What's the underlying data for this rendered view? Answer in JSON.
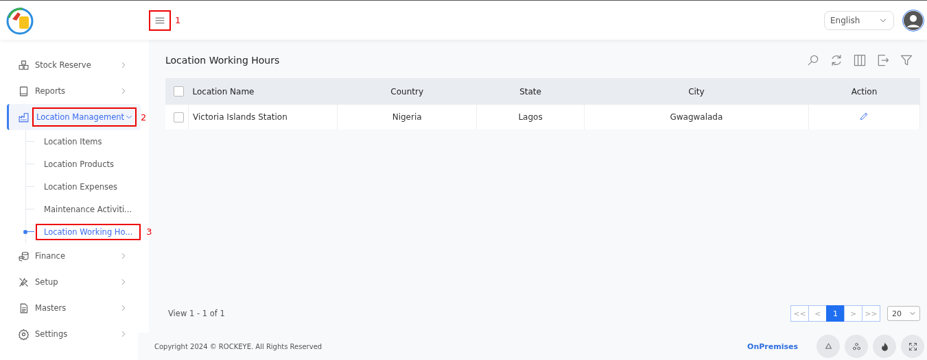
{
  "header": {
    "menu_button": {
      "annotation": "1"
    },
    "language": {
      "value": "English"
    }
  },
  "sidebar": {
    "items": [
      {
        "label": "Stock Reserve",
        "selected": false,
        "expanded": false
      },
      {
        "label": "Reports",
        "selected": false,
        "expanded": false
      },
      {
        "label": "Location Management",
        "selected": true,
        "expanded": true,
        "annotation": "2",
        "children": [
          {
            "label": "Location Items",
            "selected": false
          },
          {
            "label": "Location Products",
            "selected": false
          },
          {
            "label": "Location Expenses",
            "selected": false
          },
          {
            "label": "Maintenance Activiti...",
            "selected": false
          },
          {
            "label": "Location Working Ho...",
            "selected": true,
            "annotation": "3"
          }
        ]
      },
      {
        "label": "Finance",
        "selected": false,
        "expanded": false
      },
      {
        "label": "Setup",
        "selected": false,
        "expanded": false
      },
      {
        "label": "Masters",
        "selected": false,
        "expanded": false
      },
      {
        "label": "Settings",
        "selected": false,
        "expanded": false
      }
    ]
  },
  "page": {
    "title": "Location Working Hours"
  },
  "table": {
    "select_all": {
      "checked": false
    },
    "columns": [
      "Location Name",
      "Country",
      "State",
      "City",
      "Action"
    ],
    "rows": [
      {
        "checked": false,
        "cells": [
          "Victoria Islands Station",
          "Nigeria",
          "Lagos",
          "Gwagwalada"
        ]
      }
    ]
  },
  "pagination": {
    "summary": "View 1 - 1 of 1",
    "first": "<<",
    "prev": "<",
    "pages": [
      {
        "label": "1",
        "selected": true
      }
    ],
    "next": ">",
    "last": ">>",
    "page_size": "20"
  },
  "footer": {
    "copyright": "Copyright 2024 © ROCKEYE. All Rights Reserved",
    "mode": "OnPremises"
  }
}
